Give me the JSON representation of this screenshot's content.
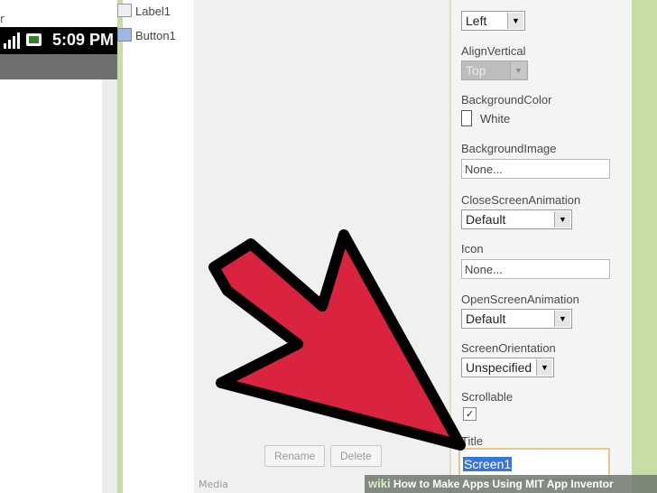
{
  "viewer": {
    "top_text": "r",
    "status_time": "5:09 PM"
  },
  "components": {
    "tree": [
      {
        "name": "Label1",
        "icon": "label-icon"
      },
      {
        "name": "Button1",
        "icon": "button-icon"
      }
    ],
    "rename_label": "Rename",
    "delete_label": "Delete",
    "bottom_text": "Media"
  },
  "properties": {
    "align_horizontal_value": "Left",
    "align_vertical_label": "AlignVertical",
    "align_vertical_value": "Top",
    "background_color_label": "BackgroundColor",
    "background_color_value": "White",
    "background_image_label": "BackgroundImage",
    "background_image_value": "None...",
    "close_screen_animation_label": "CloseScreenAnimation",
    "close_screen_animation_value": "Default",
    "icon_label": "Icon",
    "icon_value": "None...",
    "open_screen_animation_label": "OpenScreenAnimation",
    "open_screen_animation_value": "Default",
    "screen_orientation_label": "ScreenOrientation",
    "screen_orientation_value": "Unspecified",
    "scrollable_label": "Scrollable",
    "scrollable_checked": true,
    "title_label": "Title",
    "title_value": "Screen1"
  },
  "banner": {
    "wiki": "wiki",
    "how": "How to Make Apps Using MIT App Inventor"
  },
  "colors": {
    "frame_green": "#c9dba6",
    "arrow_red": "#d9233f",
    "selection_blue": "#3875d7",
    "focus_border": "#e8c88a"
  }
}
